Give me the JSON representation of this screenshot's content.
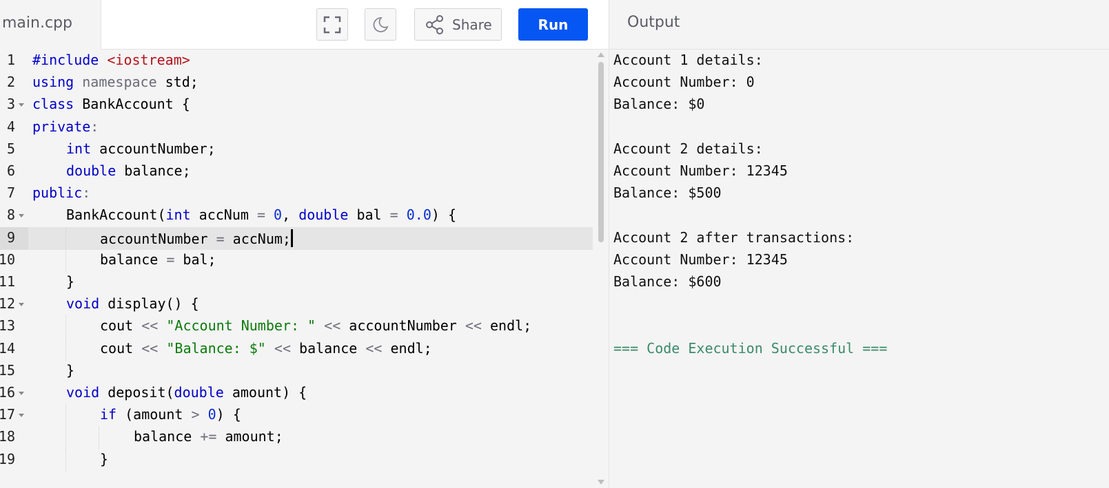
{
  "tab": {
    "filename": "main.cpp"
  },
  "toolbar": {
    "share_label": "Share",
    "run_label": "Run",
    "icons": [
      "fullscreen-icon",
      "moon-icon",
      "share-icon"
    ]
  },
  "output": {
    "title": "Output",
    "lines": [
      "Account 1 details:",
      "Account Number: 0",
      "Balance: $0",
      "",
      "Account 2 details:",
      "Account Number: 12345",
      "Balance: $500",
      "",
      "Account 2 after transactions:",
      "Account Number: 12345",
      "Balance: $600",
      "",
      "",
      "=== Code Execution Successful ==="
    ]
  },
  "editor": {
    "active_line": 9,
    "lines": [
      {
        "n": "1",
        "fold": false,
        "indent": 0,
        "tokens": [
          [
            "kw",
            "#include"
          ],
          [
            "",
            " "
          ],
          [
            "inc",
            "<iostream>"
          ]
        ]
      },
      {
        "n": "2",
        "fold": false,
        "indent": 0,
        "tokens": [
          [
            "kw",
            "using"
          ],
          [
            "",
            " "
          ],
          [
            "kw2",
            "namespace"
          ],
          [
            "",
            " std;"
          ]
        ]
      },
      {
        "n": "3",
        "fold": true,
        "indent": 0,
        "tokens": [
          [
            "kw",
            "class"
          ],
          [
            "",
            " BankAccount {"
          ]
        ]
      },
      {
        "n": "4",
        "fold": false,
        "indent": 0,
        "tokens": [
          [
            "kw",
            "private"
          ],
          [
            "op",
            ":"
          ]
        ]
      },
      {
        "n": "5",
        "fold": false,
        "indent": 1,
        "tokens": [
          [
            "kw",
            "int"
          ],
          [
            "",
            " accountNumber;"
          ]
        ]
      },
      {
        "n": "6",
        "fold": false,
        "indent": 1,
        "tokens": [
          [
            "kw",
            "double"
          ],
          [
            "",
            " balance;"
          ]
        ]
      },
      {
        "n": "7",
        "fold": false,
        "indent": 0,
        "tokens": [
          [
            "kw",
            "public"
          ],
          [
            "op",
            ":"
          ]
        ]
      },
      {
        "n": "8",
        "fold": true,
        "indent": 1,
        "tokens": [
          [
            "",
            "BankAccount("
          ],
          [
            "kw",
            "int"
          ],
          [
            "",
            " accNum "
          ],
          [
            "op",
            "="
          ],
          [
            "",
            " "
          ],
          [
            "num",
            "0"
          ],
          [
            "",
            ", "
          ],
          [
            "kw",
            "double"
          ],
          [
            "",
            " bal "
          ],
          [
            "op",
            "="
          ],
          [
            "",
            " "
          ],
          [
            "num",
            "0.0"
          ],
          [
            "",
            ") {"
          ]
        ]
      },
      {
        "n": "9",
        "fold": false,
        "indent": 2,
        "tokens": [
          [
            "",
            "accountNumber "
          ],
          [
            "op",
            "="
          ],
          [
            "",
            " accNum;"
          ]
        ],
        "cursor": true
      },
      {
        "n": "10",
        "fold": false,
        "indent": 2,
        "tokens": [
          [
            "",
            "balance "
          ],
          [
            "op",
            "="
          ],
          [
            "",
            " bal;"
          ]
        ]
      },
      {
        "n": "11",
        "fold": false,
        "indent": 1,
        "tokens": [
          [
            "",
            "}"
          ]
        ]
      },
      {
        "n": "12",
        "fold": true,
        "indent": 1,
        "tokens": [
          [
            "kw",
            "void"
          ],
          [
            "",
            " display() {"
          ]
        ]
      },
      {
        "n": "13",
        "fold": false,
        "indent": 2,
        "tokens": [
          [
            "",
            "cout "
          ],
          [
            "op",
            "<<"
          ],
          [
            "",
            " "
          ],
          [
            "str",
            "\"Account Number: \""
          ],
          [
            "",
            " "
          ],
          [
            "op",
            "<<"
          ],
          [
            "",
            " accountNumber "
          ],
          [
            "op",
            "<<"
          ],
          [
            "",
            " endl;"
          ]
        ]
      },
      {
        "n": "14",
        "fold": false,
        "indent": 2,
        "tokens": [
          [
            "",
            "cout "
          ],
          [
            "op",
            "<<"
          ],
          [
            "",
            " "
          ],
          [
            "str",
            "\"Balance: $\""
          ],
          [
            "",
            " "
          ],
          [
            "op",
            "<<"
          ],
          [
            "",
            " balance "
          ],
          [
            "op",
            "<<"
          ],
          [
            "",
            " endl;"
          ]
        ]
      },
      {
        "n": "15",
        "fold": false,
        "indent": 1,
        "tokens": [
          [
            "",
            "}"
          ]
        ]
      },
      {
        "n": "16",
        "fold": true,
        "indent": 1,
        "tokens": [
          [
            "kw",
            "void"
          ],
          [
            "",
            " deposit("
          ],
          [
            "kw",
            "double"
          ],
          [
            "",
            " amount) {"
          ]
        ]
      },
      {
        "n": "17",
        "fold": true,
        "indent": 2,
        "tokens": [
          [
            "kw",
            "if"
          ],
          [
            "",
            " (amount "
          ],
          [
            "op",
            ">"
          ],
          [
            "",
            " "
          ],
          [
            "num",
            "0"
          ],
          [
            "",
            ") {"
          ]
        ]
      },
      {
        "n": "18",
        "fold": false,
        "indent": 3,
        "tokens": [
          [
            "",
            "balance "
          ],
          [
            "op",
            "+="
          ],
          [
            "",
            " amount;"
          ]
        ]
      },
      {
        "n": "19",
        "fold": false,
        "indent": 2,
        "tokens": [
          [
            "",
            "}"
          ]
        ]
      }
    ]
  },
  "colors": {
    "run_button": "#0556f3",
    "success_text": "#3c8a6a",
    "keyword": "#0000c8",
    "string": "#0b7a0b",
    "include": "#b5121b"
  }
}
